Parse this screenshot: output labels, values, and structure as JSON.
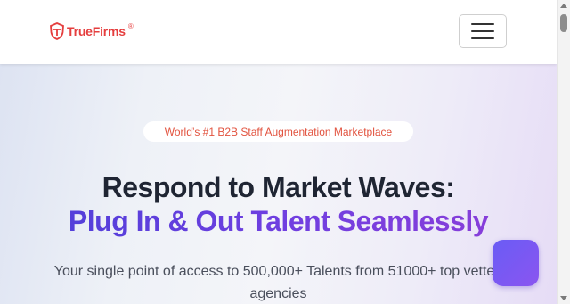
{
  "header": {
    "logo_text": "TrueFirms",
    "logo_registered": "®",
    "brand_color": "#e53e3e"
  },
  "nav": {
    "menu_icon": "hamburger-menu-icon"
  },
  "hero": {
    "badge": "World’s #1 B2B Staff Augmentation Marketplace",
    "headline_line1": "Respond to Market Waves:",
    "headline_line2": "Plug In & Out Talent Seamlessly",
    "subtext": "Your single point of access to 500,000+ Talents from 51000+ top vetted agencies",
    "accent_color": "#6f3fe0"
  },
  "floating_button": {
    "icon": "chat-widget-icon",
    "color": "#7a58f2"
  }
}
